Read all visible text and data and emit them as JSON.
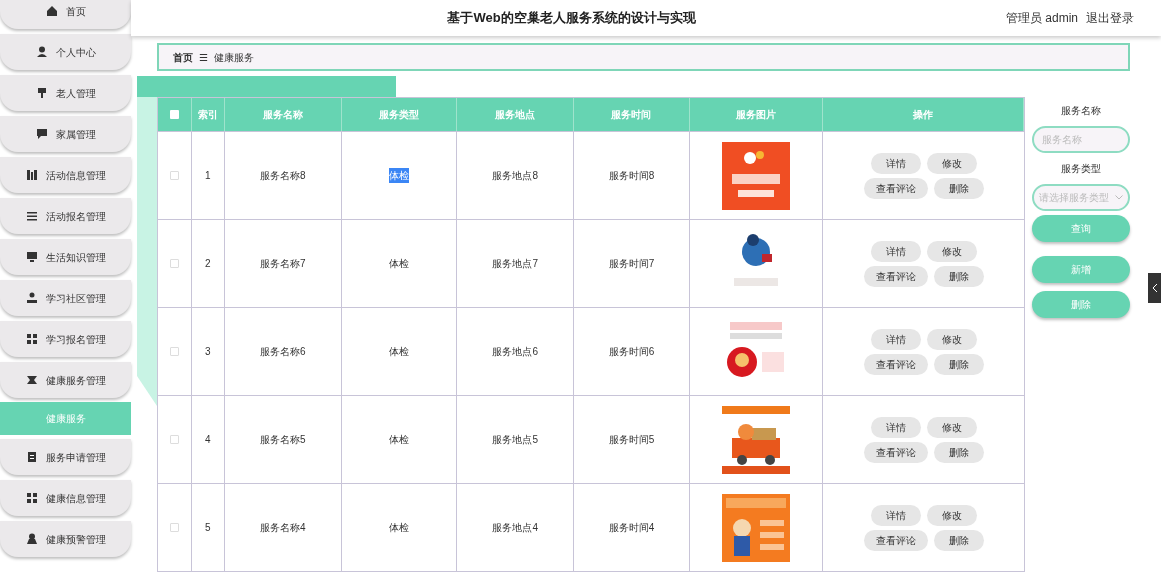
{
  "header": {
    "title": "基于Web的空巢老人服务系统的设计与实现",
    "user": "管理员 admin",
    "logout": "退出登录"
  },
  "sidebar": {
    "items": [
      {
        "label": "首页",
        "selected": false
      },
      {
        "label": "个人中心",
        "selected": false
      },
      {
        "label": "老人管理",
        "selected": false
      },
      {
        "label": "家属管理",
        "selected": false
      },
      {
        "label": "活动信息管理",
        "selected": false
      },
      {
        "label": "活动报名管理",
        "selected": false
      },
      {
        "label": "生活知识管理",
        "selected": false
      },
      {
        "label": "学习社区管理",
        "selected": false
      },
      {
        "label": "学习报名管理",
        "selected": false
      },
      {
        "label": "健康服务管理",
        "selected": false
      },
      {
        "label": "健康服务",
        "selected": true
      },
      {
        "label": "服务申请管理",
        "selected": false
      },
      {
        "label": "健康信息管理",
        "selected": false
      },
      {
        "label": "健康预警管理",
        "selected": false
      }
    ]
  },
  "breadcrumb": {
    "home": "首页",
    "separator": "☰",
    "current": "健康服务"
  },
  "table": {
    "columns": [
      "索引",
      "服务名称",
      "服务类型",
      "服务地点",
      "服务时间",
      "服务图片",
      "操作"
    ],
    "all_checked": false,
    "rows": [
      {
        "checked": false,
        "index": "1",
        "name": "服务名称8",
        "type": "体检",
        "type_highlighted": true,
        "place": "服务地点8",
        "time": "服务时间8",
        "image": {
          "kind": "picture"
        },
        "actions": [
          "详情",
          "修改",
          "查看评论",
          "删除"
        ]
      },
      {
        "checked": false,
        "index": "2",
        "name": "服务名称7",
        "type": "体检",
        "type_highlighted": false,
        "place": "服务地点7",
        "time": "服务时间7",
        "image": {
          "kind": "picture"
        },
        "actions": [
          "详情",
          "修改",
          "查看评论",
          "删除"
        ]
      },
      {
        "checked": false,
        "index": "3",
        "name": "服务名称6",
        "type": "体检",
        "type_highlighted": false,
        "place": "服务地点6",
        "time": "服务时间6",
        "image": {
          "kind": "picture"
        },
        "actions": [
          "详情",
          "修改",
          "查看评论",
          "删除"
        ]
      },
      {
        "checked": false,
        "index": "4",
        "name": "服务名称5",
        "type": "体检",
        "type_highlighted": false,
        "place": "服务地点5",
        "time": "服务时间5",
        "image": {
          "kind": "picture"
        },
        "actions": [
          "详情",
          "修改",
          "查看评论",
          "删除"
        ]
      },
      {
        "checked": false,
        "index": "5",
        "name": "服务名称4",
        "type": "体检",
        "type_highlighted": false,
        "place": "服务地点4",
        "time": "服务时间4",
        "image": {
          "kind": "picture"
        },
        "actions": [
          "详情",
          "修改",
          "查看评论",
          "删除"
        ]
      }
    ]
  },
  "search": {
    "name_label": "服务名称",
    "name_placeholder": "服务名称",
    "type_label": "服务类型",
    "type_placeholder": "请选择服务类型",
    "buttons": [
      "查询",
      "新增",
      "删除"
    ]
  }
}
